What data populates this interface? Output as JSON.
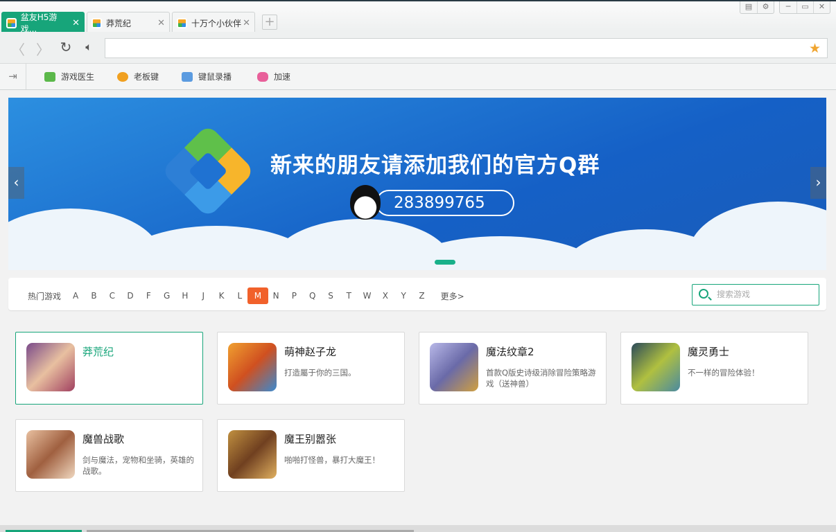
{
  "tabs": [
    {
      "label": "盆友H5游戏...",
      "active": true
    },
    {
      "label": "莽荒纪",
      "active": false
    },
    {
      "label": "十万个小伙伴",
      "active": false
    }
  ],
  "address": {
    "value": ""
  },
  "bookmarks": [
    {
      "label": "游戏医生",
      "color": "#5bb84a"
    },
    {
      "label": "老板键",
      "color": "#f0a020"
    },
    {
      "label": "键鼠录播",
      "color": "#5b9be0"
    },
    {
      "label": "加速",
      "color": "#e8609a"
    }
  ],
  "banner": {
    "headline": "新来的朋友请添加我们的官方Q群",
    "qq_group": "283899765"
  },
  "letters": {
    "hot": "热门游戏",
    "items": [
      "A",
      "B",
      "C",
      "D",
      "F",
      "G",
      "H",
      "J",
      "K",
      "L",
      "M",
      "N",
      "P",
      "Q",
      "S",
      "T",
      "W",
      "X",
      "Y",
      "Z"
    ],
    "selected": "M",
    "more": "更多>"
  },
  "search": {
    "placeholder": "搜索游戏"
  },
  "games": [
    {
      "title": "莽荒纪",
      "desc": ""
    },
    {
      "title": "萌神赵子龙",
      "desc": "打造屬于你的三国。"
    },
    {
      "title": "魔法纹章2",
      "desc": "首款Q版史诗级消除冒险策略游戏（送神兽）"
    },
    {
      "title": "魔灵勇士",
      "desc": "不一样的冒险体验！"
    },
    {
      "title": "魔兽战歌",
      "desc": "剑与魔法，宠物和坐骑，英雄的战歌。"
    },
    {
      "title": "魔王别嚣张",
      "desc": "啪啪打怪兽，暴打大魔王！"
    }
  ]
}
